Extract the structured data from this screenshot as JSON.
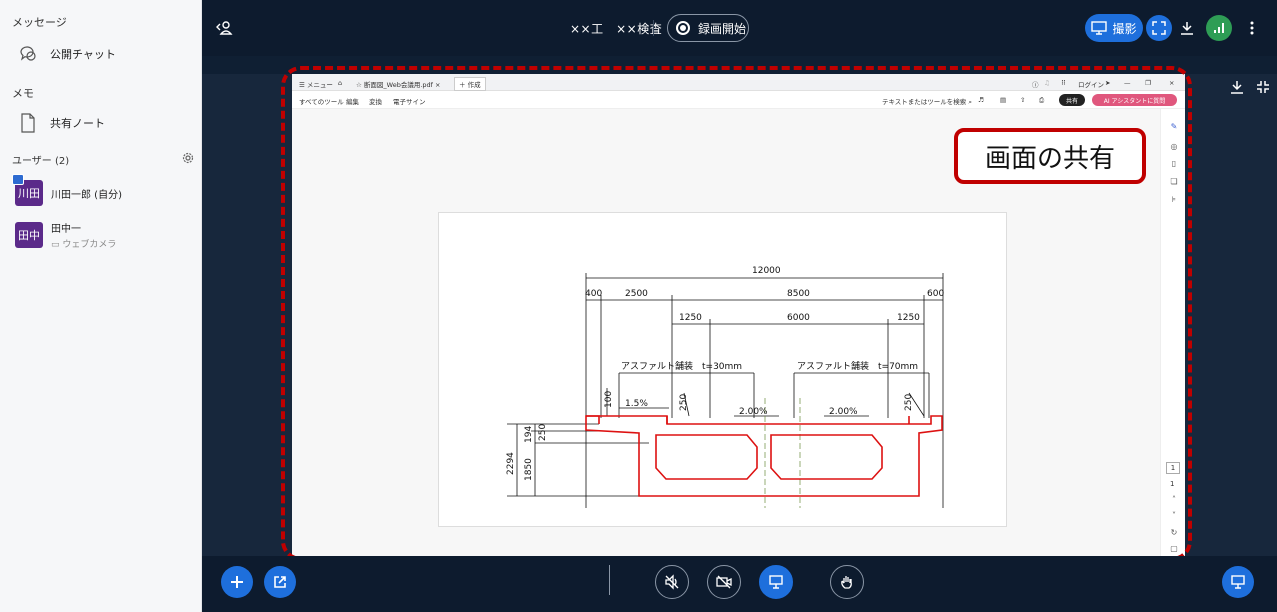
{
  "sidebar": {
    "messages_heading": "メッセージ",
    "public_chat": "公開チャット",
    "memo_heading": "メモ",
    "shared_note": "共有ノート",
    "users_heading": "ユーザー (2)",
    "users": [
      {
        "avatar": "川田",
        "name": "川田一郎 (自分)",
        "sub": ""
      },
      {
        "avatar": "田中",
        "name": "田中一",
        "sub": "ウェブカメラ"
      }
    ]
  },
  "topbar": {
    "title": "××工　××検査",
    "record_label": "録画開始",
    "camera_label": "撮影"
  },
  "shared_window": {
    "tab_menu": "メニュー",
    "tab_file": "断面図_Web会議用.pdf",
    "tab_new": "作成",
    "login": "ログイン",
    "toolbar_items": [
      "すべてのツール",
      "編集",
      "変換",
      "電子サイン"
    ],
    "search_placeholder": "テキストまたはツールを検索",
    "share_label": "共有",
    "ai_label": "AI アシスタントに質問",
    "page_current": "1",
    "page_total": "1"
  },
  "drawing": {
    "total_width": "12000",
    "dim_400": "400",
    "dim_2500": "2500",
    "dim_8500": "8500",
    "dim_600": "600",
    "dim_1250a": "1250",
    "dim_6000": "6000",
    "dim_1250b": "1250",
    "pave_left": "アスファルト舗装　t=30mm",
    "pave_right": "アスファルト舗装　t=70mm",
    "slope_15": "1.5%",
    "slope_200a": "2.00%",
    "slope_200b": "2.00%",
    "h_100": "100",
    "h_250a": "250",
    "h_250b": "250",
    "h_250c": "250",
    "h_194": "194",
    "h_1850": "1850",
    "h_2294": "2294"
  },
  "callout": "画面の共有",
  "colors": {
    "accent": "#1e6fdc",
    "highlight": "#c00000",
    "dark": "#0d1b2e",
    "avatar": "#5b2a8a"
  }
}
